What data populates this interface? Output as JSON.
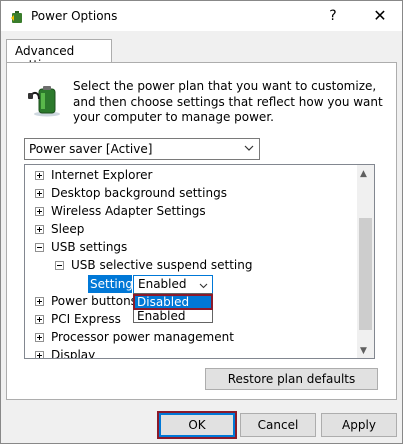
{
  "window": {
    "title": "Power Options",
    "help_glyph": "?",
    "close_glyph": "✕"
  },
  "tab": {
    "label": "Advanced settings"
  },
  "intro": {
    "text": "Select the power plan that you want to customize, and then choose settings that reflect how you want your computer to manage power."
  },
  "plan_select": {
    "value": "Power saver [Active]"
  },
  "tree": {
    "items": [
      {
        "label": "Internet Explorer",
        "state": "collapsed"
      },
      {
        "label": "Desktop background settings",
        "state": "collapsed"
      },
      {
        "label": "Wireless Adapter Settings",
        "state": "collapsed"
      },
      {
        "label": "Sleep",
        "state": "collapsed"
      },
      {
        "label": "USB settings",
        "state": "expanded"
      },
      {
        "label": "USB selective suspend setting",
        "state": "expanded"
      },
      {
        "label": "Power buttons a",
        "state": "collapsed"
      },
      {
        "label": "PCI Express",
        "state": "collapsed"
      },
      {
        "label": "Processor power management",
        "state": "collapsed"
      },
      {
        "label": "Display",
        "state": "collapsed"
      }
    ],
    "setting": {
      "label": "Setting:",
      "value": "Enabled",
      "options": [
        "Disabled",
        "Enabled"
      ],
      "highlighted": "Disabled"
    }
  },
  "buttons": {
    "restore": "Restore plan defaults",
    "ok": "OK",
    "cancel": "Cancel",
    "apply": "Apply"
  },
  "colors": {
    "accent": "#0078d7",
    "focus_outline": "#8b1a2b"
  }
}
